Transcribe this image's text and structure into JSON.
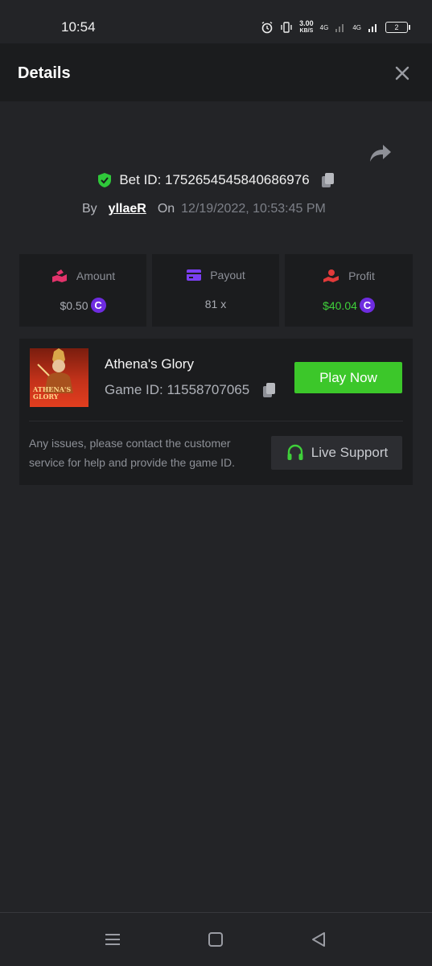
{
  "status_bar": {
    "time": "10:54",
    "speed_value": "3.00",
    "speed_unit": "KB/S",
    "network_1": "4G",
    "network_2": "4G",
    "battery": "2",
    "icons": [
      "alarm-icon",
      "vibrate-icon",
      "signal-icon",
      "signal-icon",
      "battery-icon"
    ]
  },
  "header": {
    "title": "Details",
    "close_icon": "close-icon"
  },
  "bet": {
    "id_label": "Bet ID: 1752654545840686976",
    "by_label": "By",
    "username": "yllaeR",
    "on_label": "On",
    "date": "12/19/2022, 10:53:45 PM"
  },
  "stats": {
    "amount": {
      "label": "Amount",
      "value": "$0.50",
      "icon": "money-hand-icon",
      "color": "#e2336b"
    },
    "payout": {
      "label": "Payout",
      "value": "81 x",
      "icon": "card-icon",
      "color": "#7b3ff2"
    },
    "profit": {
      "label": "Profit",
      "value": "$40.04",
      "icon": "profit-hand-icon",
      "color": "#e23a3a"
    }
  },
  "game": {
    "name": "Athena's Glory",
    "id_label": "Game ID: 11558707065",
    "thumb_text": "ATHENA'S GLORY",
    "play_label": "Play Now",
    "support_text": "Any issues, please contact the customer service for help and provide the game ID.",
    "support_label": "Live Support"
  },
  "colors": {
    "accent_green": "#3cc72a",
    "coin_purple": "#6e2ce0",
    "background": "#232427",
    "card": "#1b1c1e"
  }
}
